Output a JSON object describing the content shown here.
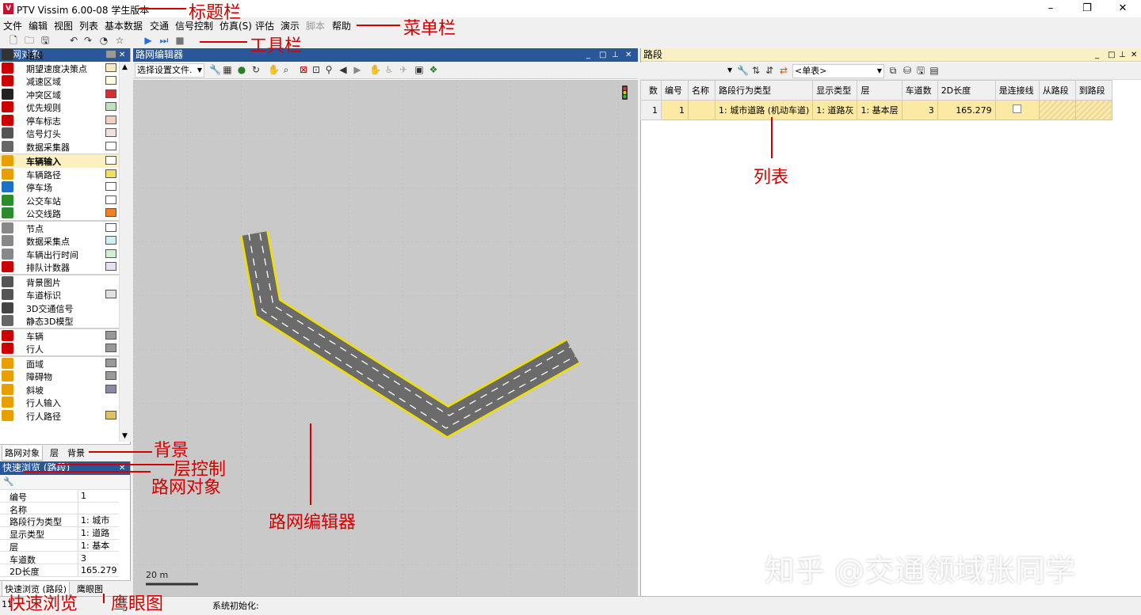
{
  "title_bar": {
    "app_title": "PTV Vissim 6.00-08 学生版本",
    "logo_text": "V",
    "minimize": "–",
    "maximize": "❐",
    "close": "✕"
  },
  "menu": [
    "文件",
    "编辑",
    "视图",
    "列表",
    "基本数据",
    "交通",
    "信号控制",
    "仿真(S)",
    "评估",
    "演示",
    "脚本",
    "帮助"
  ],
  "left_panel": {
    "title": "路网对象",
    "items": [
      {
        "label": "路段",
        "color": "#333333",
        "icon": "link-icon",
        "swatch": "#999999"
      },
      {
        "label": "期望速度决策点",
        "color": "#cc0000",
        "icon": "speed-icon",
        "swatch": "#f4ecc0"
      },
      {
        "label": "减速区域",
        "color": "#cc0000",
        "icon": "triangle-icon",
        "swatch": "#fffbe0"
      },
      {
        "label": "冲突区域",
        "color": "#222222",
        "icon": "conflict-icon",
        "swatch": "#d03030"
      },
      {
        "label": "优先规则",
        "color": "#cc0000",
        "icon": "yield-icon",
        "swatch": "#c0e0c0"
      },
      {
        "label": "停车标志",
        "color": "#cc0000",
        "icon": "stop-icon",
        "swatch": "#f0d0c0"
      },
      {
        "label": "信号灯头",
        "color": "#555555",
        "icon": "signal-icon",
        "swatch": "#f0e0e0"
      },
      {
        "label": "数据采集器",
        "color": "#666666",
        "icon": "collector-icon",
        "swatch": "#ffffff"
      },
      {
        "label": "车辆输入",
        "color": "#e8a000",
        "icon": "vehicle-input-icon",
        "swatch": "#ffffff"
      },
      {
        "label": "车辆路径",
        "color": "#e8a000",
        "icon": "route-icon",
        "swatch": "#f0e060"
      },
      {
        "label": "停车场",
        "color": "#1e6fc8",
        "icon": "parking-icon",
        "swatch": "#ffffff"
      },
      {
        "label": "公交车站",
        "color": "#2a8c2a",
        "icon": "bus-stop-icon",
        "swatch": "#ffffff"
      },
      {
        "label": "公交线路",
        "color": "#2a8c2a",
        "icon": "bus-line-icon",
        "swatch": "#f08020"
      },
      {
        "label": "节点",
        "color": "#888888",
        "icon": "node-icon",
        "swatch": "#ffffff"
      },
      {
        "label": "数据采集点",
        "color": "#888888",
        "icon": "measure-icon",
        "swatch": "#d0f0f0"
      },
      {
        "label": "车辆出行时间",
        "color": "#888888",
        "icon": "clock-icon",
        "swatch": "#d0f0d0"
      },
      {
        "label": "排队计数器",
        "color": "#cc0000",
        "icon": "queue-icon",
        "swatch": "#e8e0f0"
      },
      {
        "label": "背景图片",
        "color": "#555555",
        "icon": "image-icon",
        "swatch": ""
      },
      {
        "label": "车道标识",
        "color": "#555555",
        "icon": "lane-icon",
        "swatch": "#e0e0e0"
      },
      {
        "label": "3D交通信号",
        "color": "#444444",
        "icon": "3d-signal-icon",
        "swatch": ""
      },
      {
        "label": "静态3D模型",
        "color": "#666666",
        "icon": "3d-model-icon",
        "swatch": ""
      },
      {
        "label": "车辆",
        "color": "#cc0000",
        "icon": "car-icon",
        "swatch": "#999999"
      },
      {
        "label": "行人",
        "color": "#cc0000",
        "icon": "pedestrian-icon",
        "swatch": "#999999"
      },
      {
        "label": "面域",
        "color": "#e8a000",
        "icon": "area-icon",
        "swatch": "#999999"
      },
      {
        "label": "障碍物",
        "color": "#e8a000",
        "icon": "obstacle-icon",
        "swatch": "#999999"
      },
      {
        "label": "斜坡",
        "color": "#e8a000",
        "icon": "ramp-icon",
        "swatch": "#8888aa"
      },
      {
        "label": "行人输入",
        "color": "#e8a000",
        "icon": "ped-input-icon",
        "swatch": ""
      },
      {
        "label": "行人路径",
        "color": "#e8a000",
        "icon": "ped-route-icon",
        "swatch": "#e0c060"
      }
    ],
    "tabs": [
      "路网对象",
      "层",
      "背景"
    ]
  },
  "quick_view": {
    "title": "快速浏览 (路段)",
    "rows": [
      {
        "key": "编号",
        "value": "1"
      },
      {
        "key": "名称",
        "value": ""
      },
      {
        "key": "路段行为类型",
        "value": "1: 城市"
      },
      {
        "key": "显示类型",
        "value": "1: 道路"
      },
      {
        "key": "层",
        "value": "1: 基本"
      },
      {
        "key": "车道数",
        "value": "3"
      },
      {
        "key": "2D长度",
        "value": "165.279"
      }
    ],
    "tabs": [
      "快速浏览 (路段)",
      "鹰眼图"
    ]
  },
  "editor": {
    "title": "路网编辑器",
    "config_dropdown": "选择设置文件.",
    "scale_label": "20 m"
  },
  "list_panel": {
    "title": "路段",
    "list_dropdown": "<单表>",
    "columns": [
      "数",
      "编号",
      "名称",
      "路段行为类型",
      "显示类型",
      "层",
      "车道数",
      "2D长度",
      "是连接线",
      "从路段",
      "到路段"
    ],
    "rows": [
      {
        "count": "1",
        "id": "1",
        "name": "",
        "behavior": "1: 城市道路 (机动车道)",
        "display": "1: 道路灰",
        "level": "1: 基本层",
        "lanes": "3",
        "length": "165.279"
      }
    ]
  },
  "status": {
    "left": "11",
    "message": "系统初始化:"
  },
  "annotations": [
    "标题栏",
    "菜单栏",
    "工具栏",
    "列表",
    "背景",
    "层控制",
    "路网对象",
    "路网编辑器",
    "快速浏览",
    "鹰眼图"
  ],
  "watermark": "知乎 @交通领域张同学",
  "colors": {
    "accent": "#2b579a",
    "annotation": "#d40000",
    "road_outline": "#f0e000",
    "canvas": "#c9c9c9",
    "row_highlight": "#fce9a4"
  }
}
